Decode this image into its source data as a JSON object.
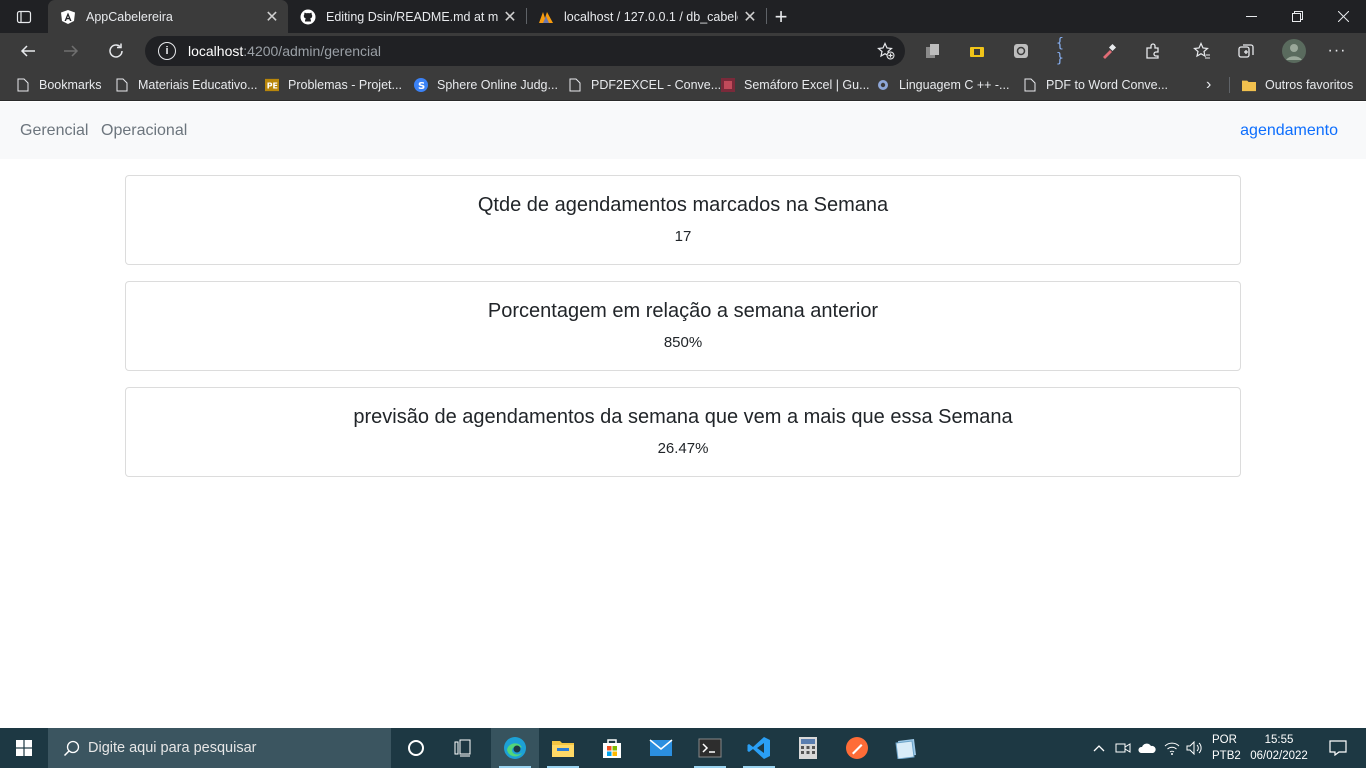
{
  "browser": {
    "tabs": [
      {
        "title": "AppCabelereira",
        "icon": "angular-icon",
        "active": true
      },
      {
        "title": "Editing Dsin/README.md at main",
        "icon": "github-icon",
        "active": false
      },
      {
        "title": "localhost / 127.0.0.1 / db_cabeler",
        "icon": "phpmyadmin-icon",
        "active": false
      }
    ],
    "address": {
      "host": "localhost",
      "path": ":4200/admin/gerencial"
    },
    "bookmarks": [
      {
        "label": "Bookmarks",
        "icon": "page-icon"
      },
      {
        "label": "Materiais Educativo...",
        "icon": "page-icon"
      },
      {
        "label": "Problemas - Projet...",
        "icon": "pe-icon"
      },
      {
        "label": "Sphere Online Judg...",
        "icon": "spoj-icon"
      },
      {
        "label": "PDF2EXCEL - Conve...",
        "icon": "page-icon"
      },
      {
        "label": "Semáforo Excel | Gu...",
        "icon": "excel-icon"
      },
      {
        "label": "Linguagem C ++ -...",
        "icon": "c-icon"
      },
      {
        "label": "PDF to Word Conve...",
        "icon": "page-icon"
      }
    ],
    "other_bookmarks": "Outros favoritos"
  },
  "app_nav": {
    "left": [
      "Gerencial",
      "Operacional"
    ],
    "right": "agendamento"
  },
  "cards": [
    {
      "title": "Qtde de agendamentos marcados na Semana",
      "value": "17"
    },
    {
      "title": "Porcentagem em relação a semana anterior",
      "value": "850%"
    },
    {
      "title": "previsão de agendamentos da semana que vem a mais que essa Semana",
      "value": "26.47%"
    }
  ],
  "taskbar": {
    "search_placeholder": "Digite aqui para pesquisar",
    "lang_line1": "POR",
    "lang_line2": "PTB2",
    "time": "15:55",
    "date": "06/02/2022"
  },
  "colors": {
    "link_active": "#0d6efd",
    "nav_text": "#6c757d",
    "taskbar": "#1d3843"
  }
}
